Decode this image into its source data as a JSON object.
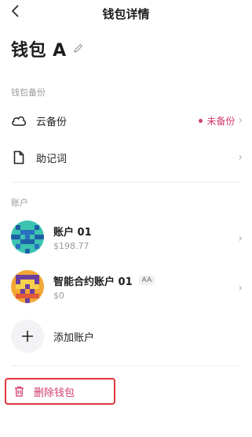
{
  "header": {
    "title": "钱包详情",
    "back_icon": "chevron-left-icon"
  },
  "wallet": {
    "name": "钱包 A",
    "edit_icon": "pencil-icon"
  },
  "backup_section": {
    "label": "钱包备份",
    "items": [
      {
        "label": "云备份",
        "icon": "cloud-icon",
        "status": "未备份",
        "status_color": "#d13b6d"
      },
      {
        "label": "助记词",
        "icon": "document-icon"
      }
    ]
  },
  "accounts_section": {
    "label": "账户",
    "items": [
      {
        "name": "账户 01",
        "balance": "$198.77",
        "tag": ""
      },
      {
        "name": "智能合约账户 01",
        "balance": "$0",
        "tag": "AA"
      }
    ],
    "add_label": "添加账户"
  },
  "delete": {
    "label": "删除钱包",
    "icon": "trash-icon",
    "color": "#d13b6d"
  }
}
